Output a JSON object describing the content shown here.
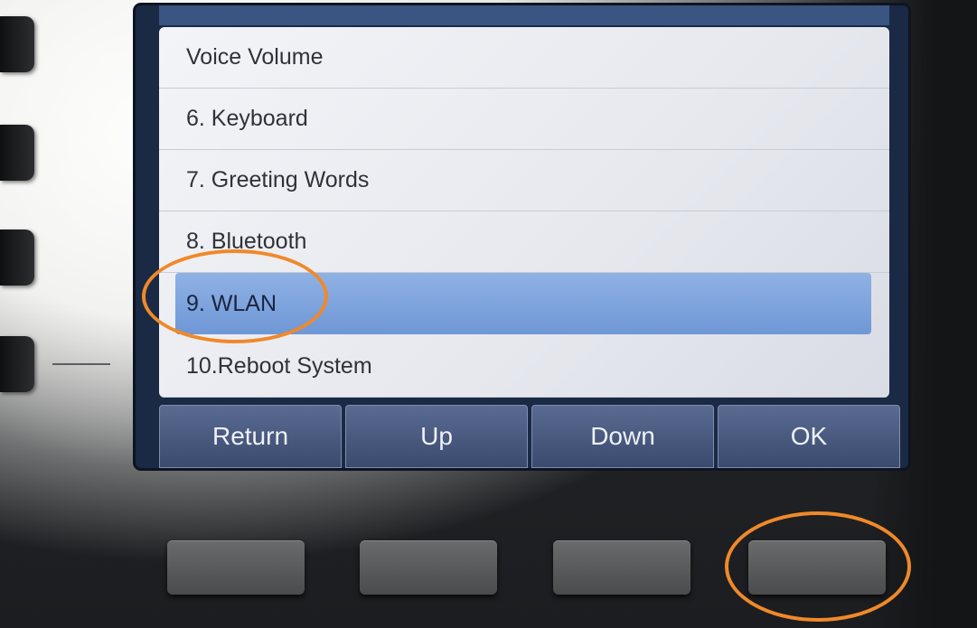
{
  "menu": {
    "items": [
      {
        "label": "Voice Volume"
      },
      {
        "label": "6. Keyboard"
      },
      {
        "label": "7. Greeting Words"
      },
      {
        "label": "8. Bluetooth"
      },
      {
        "label": "9. WLAN",
        "selected": true
      },
      {
        "label": "10.Reboot System"
      }
    ]
  },
  "softkeys": [
    {
      "label": "Return"
    },
    {
      "label": "Up"
    },
    {
      "label": "Down"
    },
    {
      "label": "OK"
    }
  ],
  "colors": {
    "selection": "#7ea6de",
    "highlight_ring": "#f0892a",
    "softkey_bar": "#4a5a80"
  }
}
